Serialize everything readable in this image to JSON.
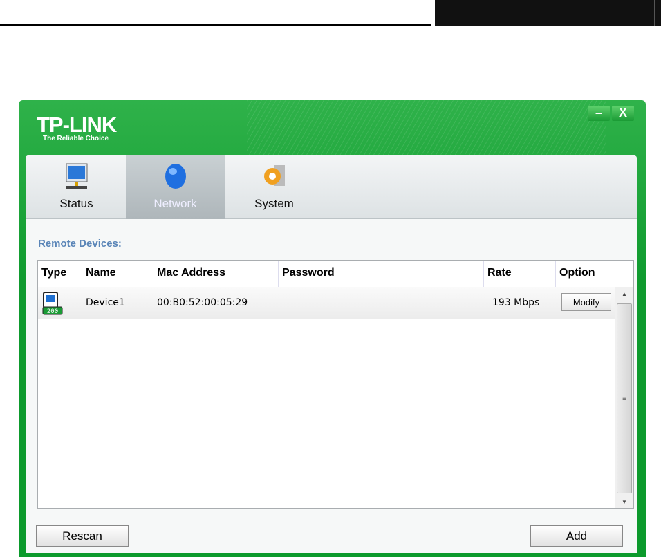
{
  "brand": {
    "logo": "TP-LINK",
    "tagline": "The Reliable Choice"
  },
  "window_buttons": {
    "minimize": "–",
    "close": "X"
  },
  "tabs": [
    {
      "label": "Status"
    },
    {
      "label": "Network",
      "active": true
    },
    {
      "label": "System"
    }
  ],
  "section_title": "Remote Devices:",
  "table": {
    "headers": [
      "Type",
      "Name",
      "Mac Address",
      "Password",
      "Rate",
      "Option"
    ],
    "rows": [
      {
        "type": "device-200",
        "name": "Device1",
        "mac": "00:B0:52:00:05:29",
        "password": "",
        "rate": "193 Mbps",
        "option": "Modify"
      }
    ]
  },
  "buttons": {
    "rescan": "Rescan",
    "add": "Add"
  },
  "colors": {
    "brand_green": "#0f9a2e",
    "section_blue": "#5b86b8"
  }
}
